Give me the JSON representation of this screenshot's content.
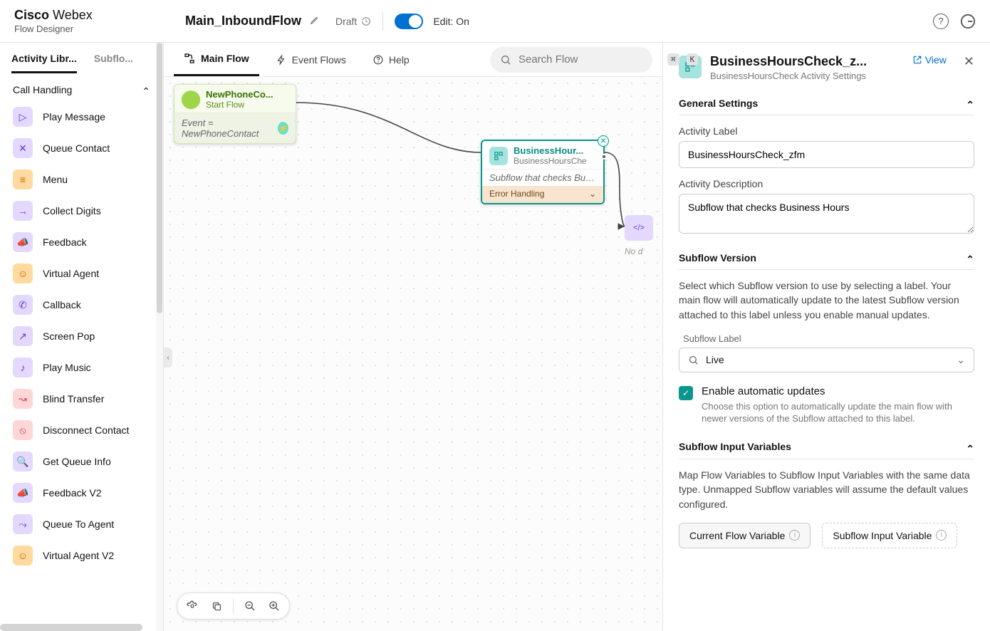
{
  "header": {
    "brand_bold": "Cisco",
    "brand_light": "Webex",
    "brand_sub": "Flow Designer",
    "flow_name": "Main_InboundFlow",
    "draft_label": "Draft",
    "edit_label": "Edit: On"
  },
  "sidebar": {
    "tabs": {
      "active": "Activity Libr...",
      "other": "Subflo..."
    },
    "section": "Call Handling",
    "items": [
      {
        "label": "Play Message",
        "cls": "ic-purple",
        "glyph": "▷"
      },
      {
        "label": "Queue Contact",
        "cls": "ic-purple",
        "glyph": "✕"
      },
      {
        "label": "Menu",
        "cls": "ic-orange",
        "glyph": "≡"
      },
      {
        "label": "Collect Digits",
        "cls": "ic-purple",
        "glyph": "→"
      },
      {
        "label": "Feedback",
        "cls": "ic-purple",
        "glyph": "📣"
      },
      {
        "label": "Virtual Agent",
        "cls": "ic-orange",
        "glyph": "☺"
      },
      {
        "label": "Callback",
        "cls": "ic-purple",
        "glyph": "✆"
      },
      {
        "label": "Screen Pop",
        "cls": "ic-purple",
        "glyph": "↗"
      },
      {
        "label": "Play Music",
        "cls": "ic-purple",
        "glyph": "♪"
      },
      {
        "label": "Blind Transfer",
        "cls": "ic-red",
        "glyph": "↝"
      },
      {
        "label": "Disconnect Contact",
        "cls": "ic-red",
        "glyph": "⦸"
      },
      {
        "label": "Get Queue Info",
        "cls": "ic-purple",
        "glyph": "🔍"
      },
      {
        "label": "Feedback V2",
        "cls": "ic-purple",
        "glyph": "📣"
      },
      {
        "label": "Queue To Agent",
        "cls": "ic-purple",
        "glyph": "⤳"
      },
      {
        "label": "Virtual Agent V2",
        "cls": "ic-orange",
        "glyph": "☺"
      }
    ]
  },
  "canvas_tabs": {
    "main": "Main Flow",
    "event": "Event Flows",
    "help": "Help",
    "search_placeholder": "Search Flow"
  },
  "nodes": {
    "start": {
      "title": "NewPhoneCo...",
      "sub": "Start Flow",
      "event": "Event = NewPhoneContact"
    },
    "bh": {
      "title": "BusinessHour...",
      "sub": "BusinessHoursChe",
      "desc": "Subflow that checks Busin...",
      "err": "Error Handling"
    },
    "http": {
      "glyph": "</>",
      "desc": "No d"
    }
  },
  "props": {
    "title": "BusinessHoursCheck_z...",
    "sub": "BusinessHoursCheck Activity Settings",
    "view": "View",
    "general": {
      "head": "General Settings",
      "label_field": "Activity Label",
      "label_value": "BusinessHoursCheck_zfm",
      "desc_field": "Activity Description",
      "desc_value": "Subflow that checks Business Hours"
    },
    "version": {
      "head": "Subflow Version",
      "desc": "Select which Subflow version to use by selecting a label. Your main flow will automatically update to the latest Subflow version attached to this label unless you enable manual updates.",
      "label": "Subflow Label",
      "value": "Live",
      "auto_label": "Enable automatic updates",
      "auto_desc": "Choose this option to automatically update the main flow with newer versions of the Subflow attached to this label."
    },
    "inputs": {
      "head": "Subflow Input Variables",
      "desc": "Map Flow Variables to Subflow Input Variables with the same data type. Unmapped Subflow variables will assume the default values configured.",
      "btn1": "Current Flow Variable",
      "btn2": "Subflow Input Variable"
    }
  }
}
